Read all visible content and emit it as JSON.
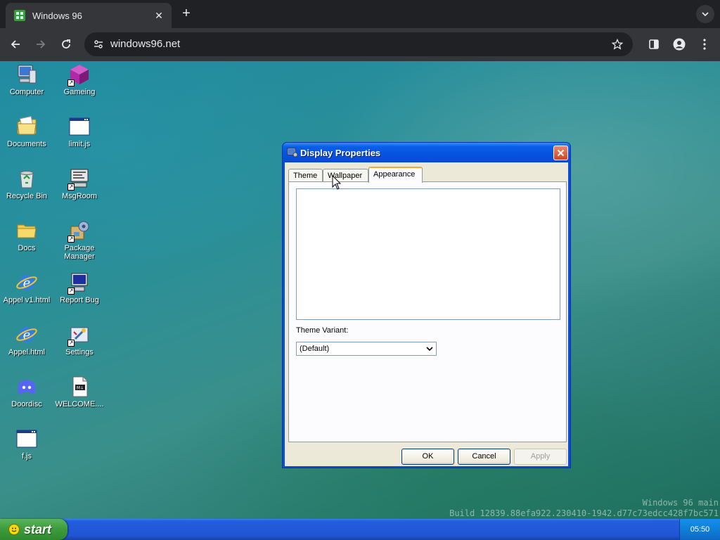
{
  "browser": {
    "tab_title": "Windows 96",
    "url": "windows96.net"
  },
  "desktop": {
    "icons": [
      {
        "label": "Computer",
        "icon": "computer-icon"
      },
      {
        "label": "Gameing",
        "icon": "cube-icon"
      },
      {
        "label": "Documents",
        "icon": "documents-icon"
      },
      {
        "label": "limit.js",
        "icon": "window-file-icon"
      },
      {
        "label": "Recycle Bin",
        "icon": "recycle-bin-icon"
      },
      {
        "label": "MsgRoom",
        "icon": "msgroom-icon"
      },
      {
        "label": "Docs",
        "icon": "folder-icon"
      },
      {
        "label": "Package Manager",
        "icon": "package-manager-icon"
      },
      {
        "label": "Appel v1.html",
        "icon": "ie-icon"
      },
      {
        "label": "Report Bug",
        "icon": "report-bug-icon"
      },
      {
        "label": "Appel.html",
        "icon": "ie-icon"
      },
      {
        "label": "Settings",
        "icon": "settings-icon"
      },
      {
        "label": "Doordisc",
        "icon": "discord-icon"
      },
      {
        "label": "WELCOME....",
        "icon": "markdown-file-icon"
      },
      {
        "label": "f.js",
        "icon": "window-file-icon"
      }
    ],
    "watermark": {
      "line1": "Windows 96 main",
      "line2": "Build 12839.88efa922.230410-1942.d77c73edcc428f7bc571"
    }
  },
  "dialog": {
    "title": "Display Properties",
    "tabs": [
      {
        "label": "Theme",
        "active": false
      },
      {
        "label": "Wallpaper",
        "active": false
      },
      {
        "label": "Appearance",
        "active": true
      }
    ],
    "theme_variant_label": "Theme Variant:",
    "theme_variant_value": "(Default)",
    "buttons": {
      "ok": "OK",
      "cancel": "Cancel",
      "apply": "Apply"
    }
  },
  "taskbar": {
    "start_label": "start",
    "clock": "05:50"
  }
}
